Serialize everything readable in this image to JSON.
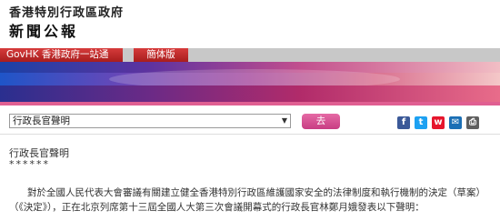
{
  "header": {
    "gov_name": "香港特別行政區政府",
    "site_title": "新聞公報"
  },
  "nav": {
    "home_label": "GovHK 香港政府一站通",
    "lang_label": "簡体版"
  },
  "filter": {
    "selected": "行政長官聲明",
    "go_label": "去"
  },
  "share": [
    {
      "name": "facebook-icon",
      "glyph": "f"
    },
    {
      "name": "twitter-icon",
      "glyph": "t"
    },
    {
      "name": "weibo-icon",
      "glyph": "w"
    },
    {
      "name": "email-icon",
      "glyph": "✉"
    },
    {
      "name": "print-icon",
      "glyph": "⎙"
    }
  ],
  "article": {
    "heading": "行政長官聲明",
    "stars": "******",
    "body_line1": "對於全國人民代表大會審議有關建立健全香港特別行政區維護國家安全的法律制度和執行機制的決定（草案）",
    "body_line2": "（《決定》），正在北京列席第十三屆全國人大第三次會議開幕式的行政長官林鄭月娥發表以下聲明："
  }
}
